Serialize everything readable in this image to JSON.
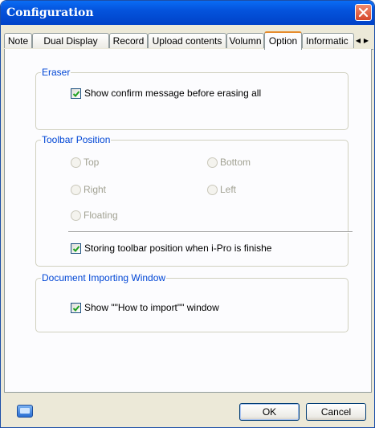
{
  "window": {
    "title": "Configuration"
  },
  "tabs": [
    {
      "label": "Note"
    },
    {
      "label": "Dual Display"
    },
    {
      "label": "Record"
    },
    {
      "label": "Upload contents"
    },
    {
      "label": "Volumn"
    },
    {
      "label": "Option",
      "active": true
    },
    {
      "label": "Informatic"
    }
  ],
  "tab_scroll": {
    "left": "◀",
    "right": "▶"
  },
  "eraser": {
    "legend": "Eraser",
    "confirm_label": "Show confirm message before erasing all",
    "confirm_checked": true
  },
  "toolbar_position": {
    "legend": "Toolbar Position",
    "options": {
      "top": "Top",
      "bottom": "Bottom",
      "right": "Right",
      "left": "Left",
      "floating": "Floating"
    },
    "options_enabled": false,
    "store_label": "Storing toolbar position when i-Pro is finishe",
    "store_checked": true
  },
  "document_import": {
    "legend": "Document Importing Window",
    "show_label": "Show \"\"How to import\"\" window",
    "show_checked": true
  },
  "buttons": {
    "ok": "OK",
    "cancel": "Cancel"
  },
  "colors": {
    "title_bar": "#0453dc",
    "legend_text": "#0046d5",
    "active_tab_accent": "#e68b2c",
    "close_button": "#d5462a"
  },
  "icons": {
    "close": "close-icon",
    "check": "checkmark-icon",
    "monitor": "monitor-icon"
  }
}
